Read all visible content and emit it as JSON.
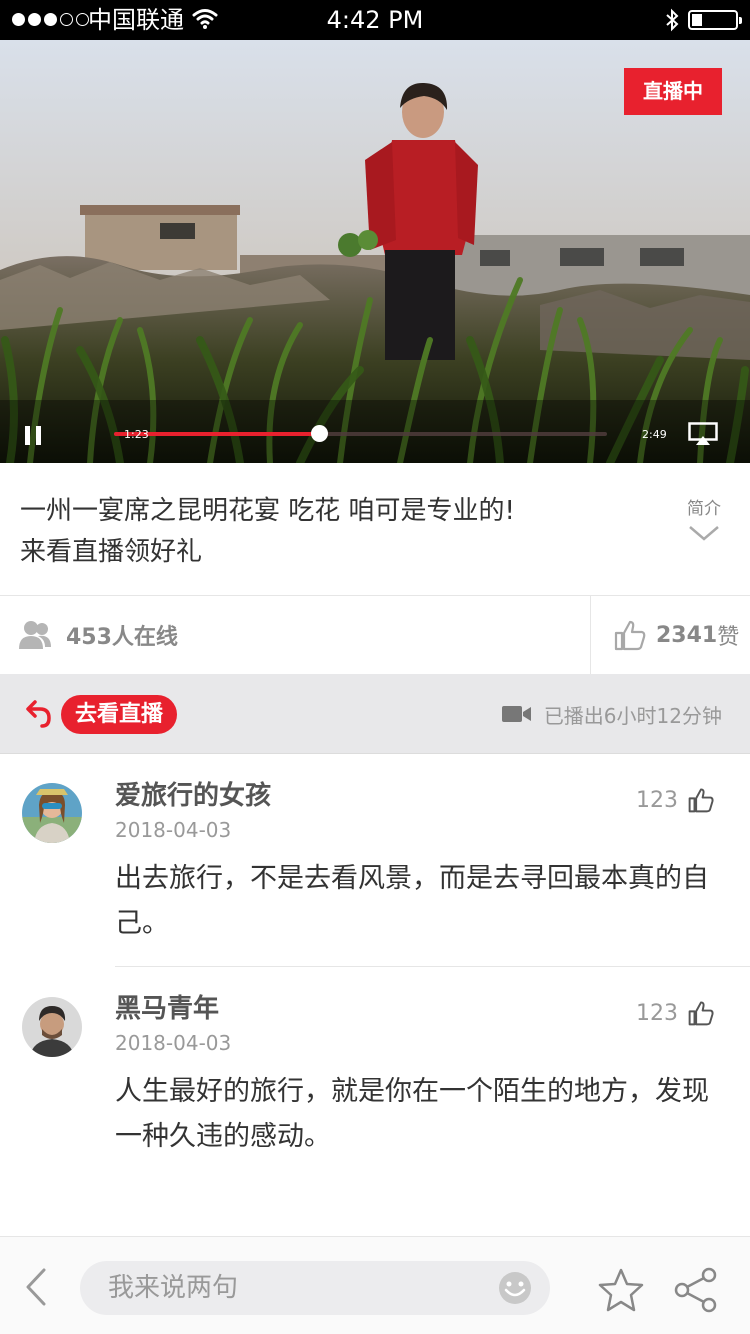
{
  "status_bar": {
    "carrier": "中国联通",
    "time": "4:42 PM",
    "signal_bars_filled": 3,
    "signal_bars_total": 5,
    "icons": [
      "wifi-icon",
      "bluetooth-icon",
      "battery-icon"
    ]
  },
  "video": {
    "live_badge": "直播中",
    "current_time": "1:23",
    "total_time": "2:49",
    "progress": 0.415,
    "accent_color": "#e8212e",
    "icons": [
      "pause-icon",
      "airplay-icon"
    ]
  },
  "title": {
    "line1": "一州一宴席之昆明花宴 吃花 咱可是专业的!",
    "line2": "来看直播领好礼",
    "intro_label": "简介"
  },
  "stats": {
    "online": "453人在线",
    "likes_count": "2341",
    "likes_unit": "赞"
  },
  "live_bar": {
    "go_live": "去看直播",
    "aired": "已播出6小时12分钟"
  },
  "comments": [
    {
      "name": "爱旅行的女孩",
      "date": "2018-04-03",
      "likes": "123",
      "text": "出去旅行，不是去看风景，而是去寻回最本真的自己。"
    },
    {
      "name": "黑马青年",
      "date": "2018-04-03",
      "likes": "123",
      "text": "人生最好的旅行，就是你在一个陌生的地方，发现一种久违的感动。"
    }
  ],
  "bottom_bar": {
    "input_placeholder": "我来说两句",
    "icons": [
      "back-chevron-icon",
      "emoji-icon",
      "star-icon",
      "share-icon"
    ]
  }
}
